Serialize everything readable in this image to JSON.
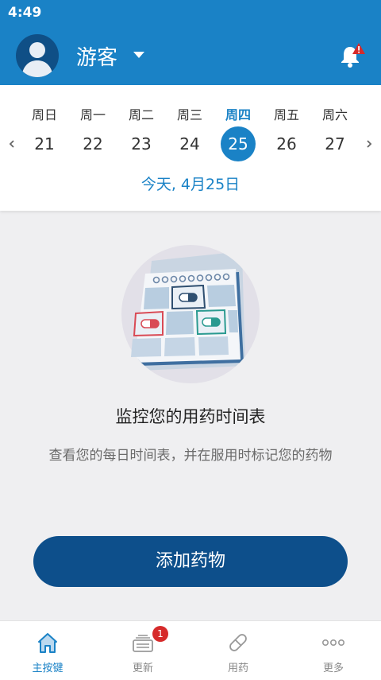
{
  "status_bar": {
    "time": "4:49"
  },
  "header": {
    "username": "游客",
    "avatar_icon": "user-avatar-icon",
    "alert_icon": "bell-alert-icon"
  },
  "calendar": {
    "weekdays": [
      "周日",
      "周一",
      "周二",
      "周三",
      "周四",
      "周五",
      "周六"
    ],
    "days": [
      "21",
      "22",
      "23",
      "24",
      "25",
      "26",
      "27"
    ],
    "selected_index": 4,
    "today_label": "今天, 4月25日"
  },
  "empty_state": {
    "illustration_icon": "calendar-pills-icon",
    "title": "监控您的用药时间表",
    "description": "查看您的每日时间表，并在服用时标记您的药物"
  },
  "add_button": {
    "label": "添加药物"
  },
  "tabs": [
    {
      "label": "主按键",
      "icon": "home-icon",
      "active": true
    },
    {
      "label": "更新",
      "icon": "updates-icon",
      "badge": "1"
    },
    {
      "label": "用药",
      "icon": "pill-icon"
    },
    {
      "label": "更多",
      "icon": "more-icon"
    }
  ],
  "colors": {
    "primary": "#1a82c6",
    "button": "#0d4f8b",
    "badge": "#d62b2b"
  }
}
